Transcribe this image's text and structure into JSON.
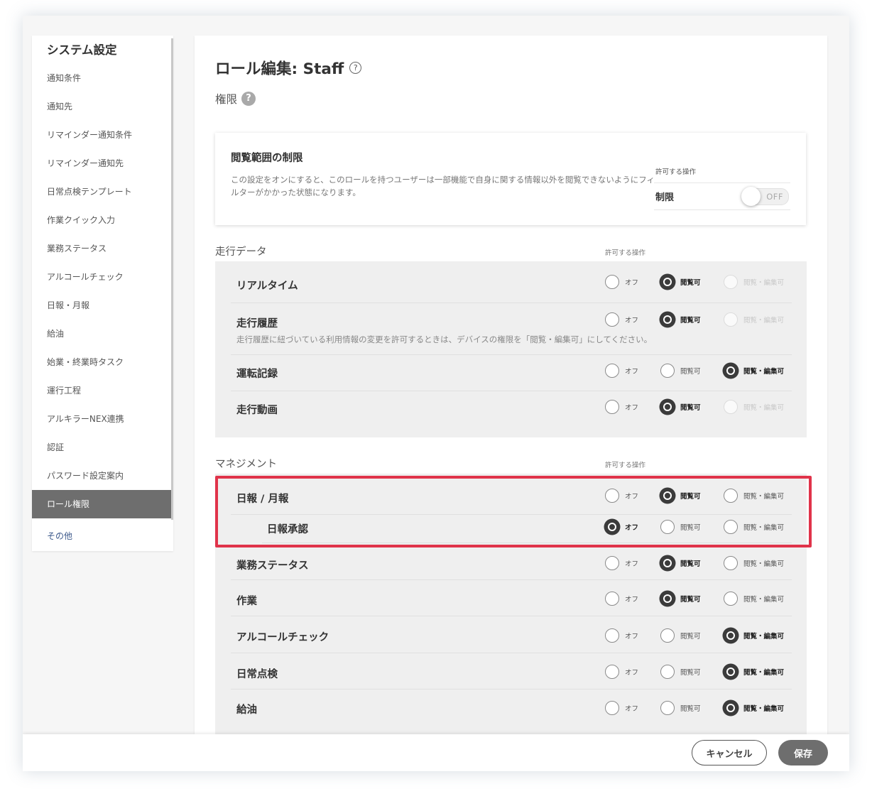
{
  "sidebar": {
    "title": "システム設定",
    "items": [
      {
        "label": "通知条件"
      },
      {
        "label": "通知先"
      },
      {
        "label": "リマインダー通知条件"
      },
      {
        "label": "リマインダー通知先"
      },
      {
        "label": "日常点検テンプレート"
      },
      {
        "label": "作業クイック入力"
      },
      {
        "label": "業務ステータス"
      },
      {
        "label": "アルコールチェック"
      },
      {
        "label": "日報・月報"
      },
      {
        "label": "給油"
      },
      {
        "label": "始業・終業時タスク"
      },
      {
        "label": "運行工程"
      },
      {
        "label": "アルキラーNEX連携"
      },
      {
        "label": "認証"
      },
      {
        "label": "パスワード設定案内"
      },
      {
        "label": "ロール権限",
        "active": true
      },
      {
        "label": "その他"
      }
    ]
  },
  "page": {
    "title": "ロール編集: Staff",
    "title_help": "?",
    "permissions_label": "権限",
    "permissions_help": "?"
  },
  "restriction_card": {
    "title": "閲覧範囲の制限",
    "description": "この設定をオンにすると、このロールを持つユーザーは一部機能で自身に関する情報以外を閲覧できないようにフィルターがかかった状態になります。",
    "ops_label": "許可する操作",
    "restrict_label": "制限",
    "toggle_text": "OFF",
    "toggle_on": false
  },
  "options": {
    "off": "オフ",
    "view": "閲覧可",
    "edit": "閲覧・編集可"
  },
  "sections": [
    {
      "title": "走行データ",
      "ops_label": "許可する操作",
      "rows": [
        {
          "label": "リアルタイム",
          "selected": "view",
          "edit_disabled": true
        },
        {
          "label": "走行履歴",
          "selected": "view",
          "edit_disabled": true,
          "note": "走行履歴に紐づいている利用情報の変更を許可するときは、デバイスの権限を「閲覧・編集可」にしてください。"
        },
        {
          "label": "運転記録",
          "selected": "edit"
        },
        {
          "label": "走行動画",
          "selected": "view",
          "edit_disabled": true
        }
      ]
    },
    {
      "title": "マネジメント",
      "ops_label": "許可する操作",
      "rows": [
        {
          "label": "日報 / 月報",
          "selected": "view"
        },
        {
          "label": "日報承認",
          "selected": "off",
          "indent": true
        },
        {
          "label": "業務ステータス",
          "selected": "view"
        },
        {
          "label": "作業",
          "selected": "view"
        },
        {
          "label": "アルコールチェック",
          "selected": "edit"
        },
        {
          "label": "日常点検",
          "selected": "edit"
        },
        {
          "label": "給油",
          "selected": "edit"
        }
      ]
    }
  ],
  "footer": {
    "cancel_label": "キャンセル",
    "save_label": "保存"
  },
  "colors": {
    "highlight": "#e0334a",
    "active_sidebar": "#6e6e6e",
    "panel_bg": "#efefef"
  }
}
